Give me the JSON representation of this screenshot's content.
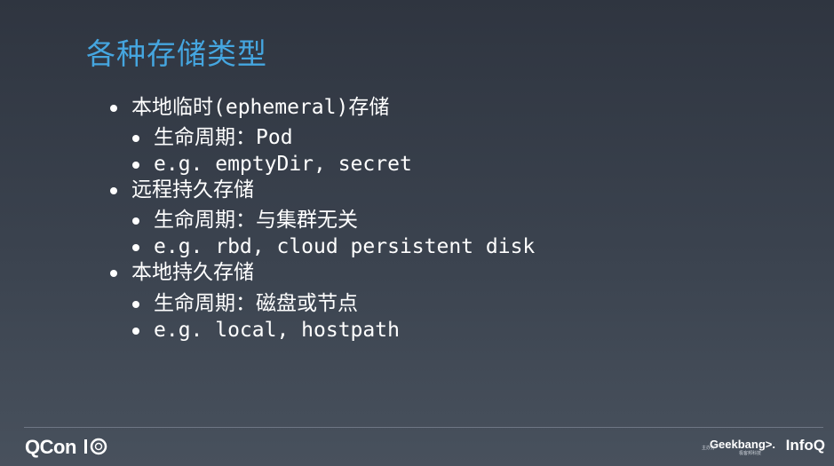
{
  "slide": {
    "title": "各种存储类型",
    "bullets": [
      {
        "level": 1,
        "text": "本地临时(ephemeral)存储"
      },
      {
        "level": 2,
        "text": "生命周期：Pod"
      },
      {
        "level": 2,
        "text": "e.g. emptyDir, secret"
      },
      {
        "level": 1,
        "text": "远程持久存储"
      },
      {
        "level": 2,
        "text": "生命周期：与集群无关"
      },
      {
        "level": 2,
        "text": "e.g. rbd, cloud persistent disk"
      },
      {
        "level": 1,
        "text": "本地持久存储"
      },
      {
        "level": 2,
        "text": "生命周期：磁盘或节点"
      },
      {
        "level": 2,
        "text": "e.g. local, hostpath"
      }
    ]
  },
  "footer": {
    "qcon_logo": "QCon",
    "host_label": "主办方",
    "geekbang_logo": "Geekbang>.",
    "geekbang_sub": "极客邦科技",
    "infoq_logo": "InfoQ"
  },
  "colors": {
    "title": "#45a6e0",
    "text": "#ffffff",
    "background_top": "#2f3540",
    "background_bottom": "#48515d"
  }
}
